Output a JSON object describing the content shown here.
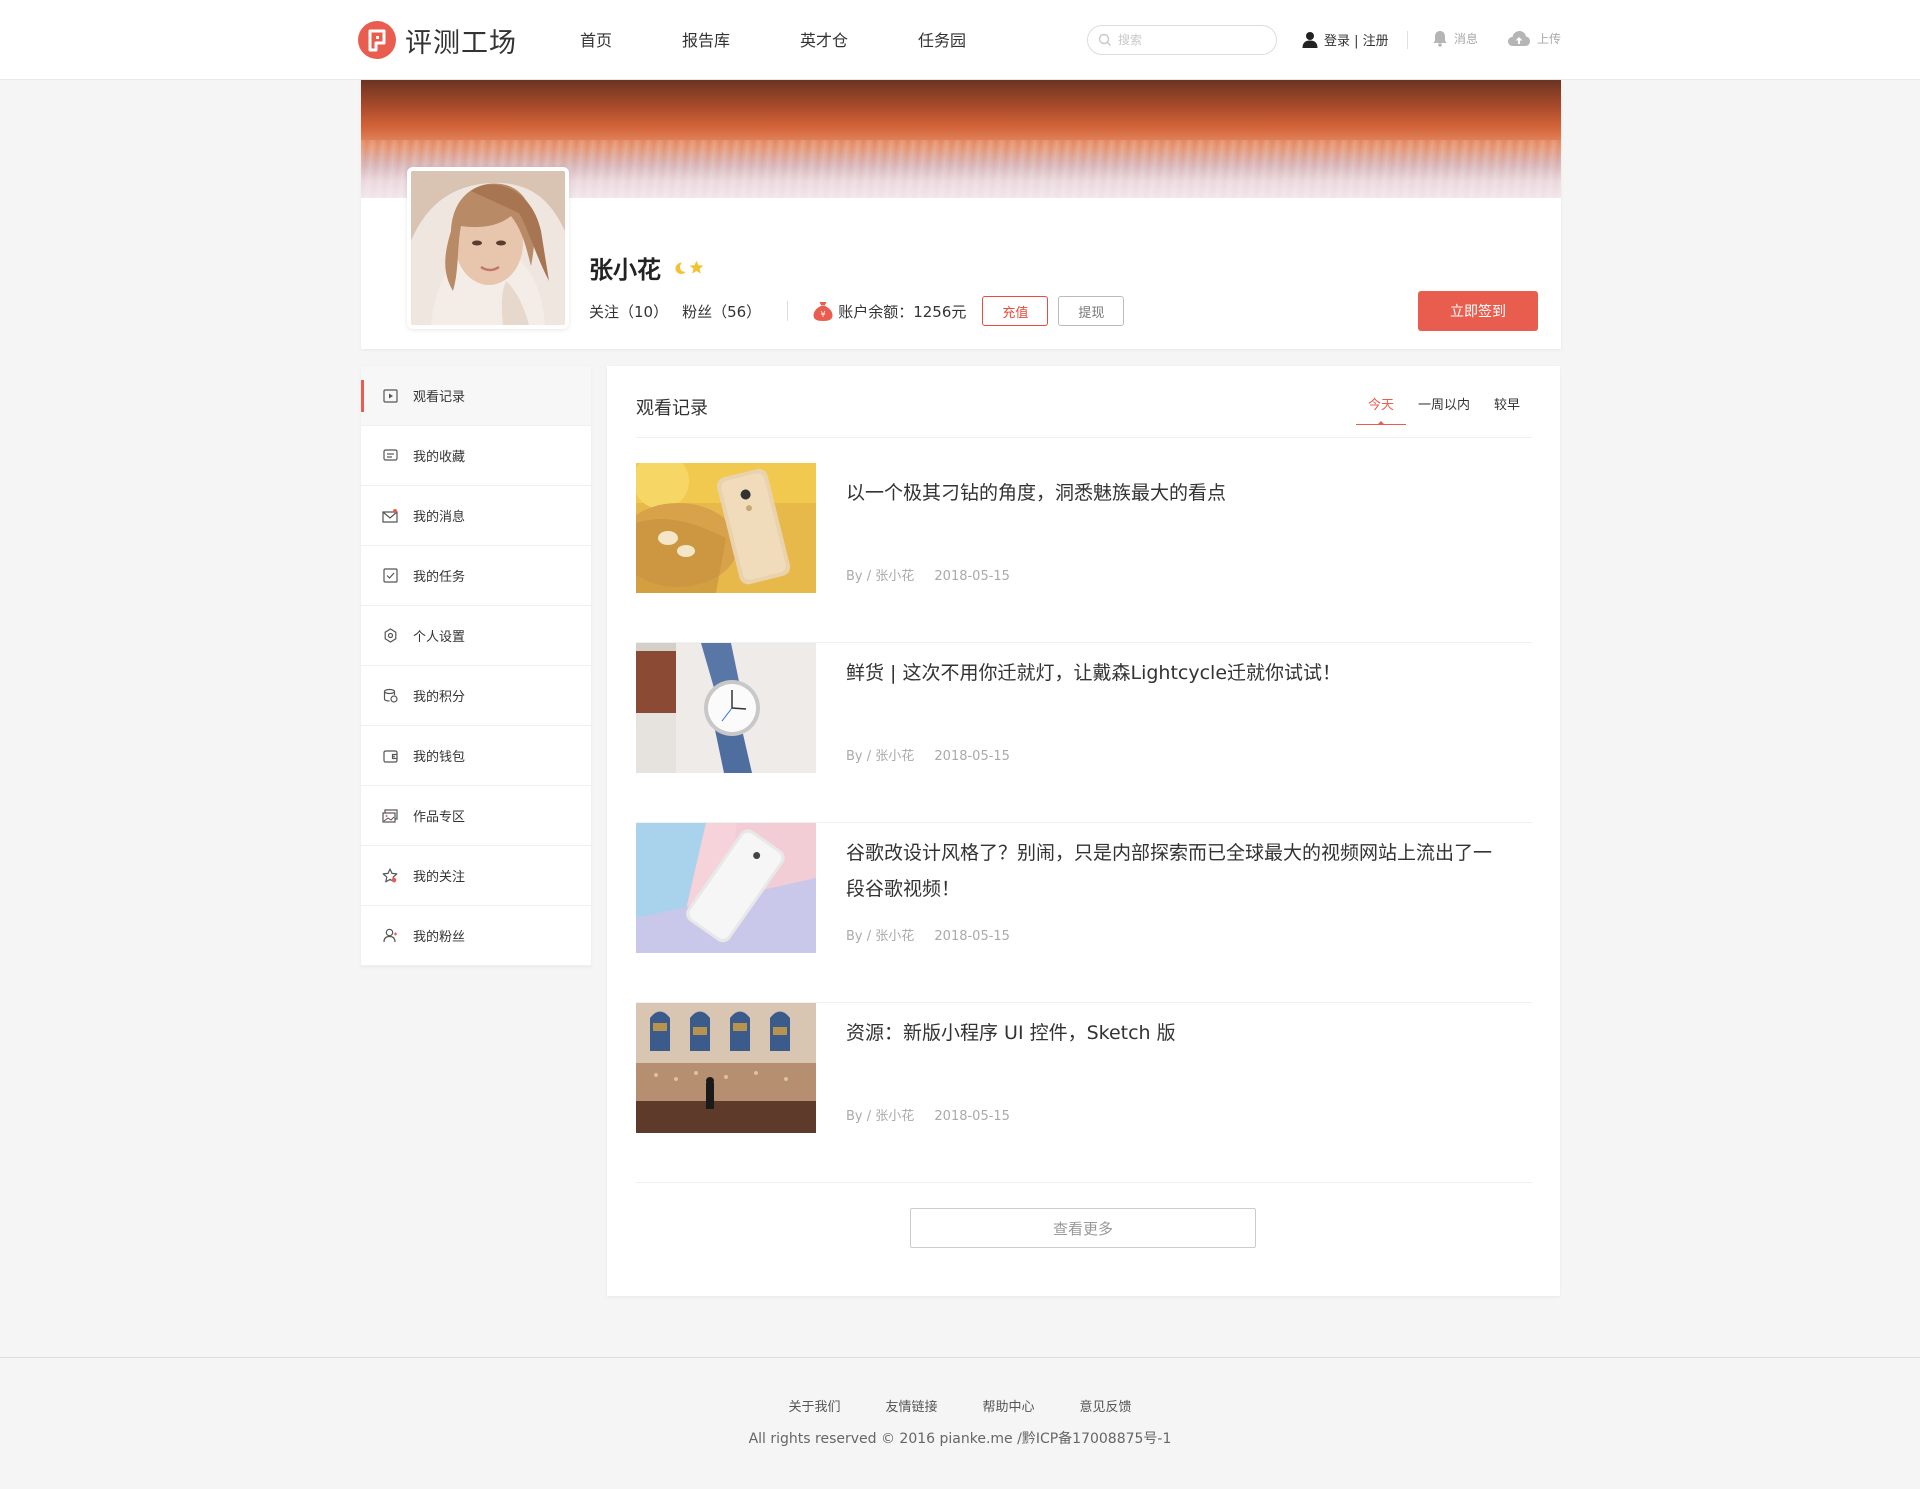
{
  "header": {
    "logo_text": "评测工场",
    "nav": [
      "首页",
      "报告库",
      "英才仓",
      "任务园"
    ],
    "search_placeholder": "搜索",
    "login_text": "登录 | 注册",
    "messages_label": "消息",
    "upload_label": "上传"
  },
  "profile": {
    "username": "张小花",
    "follow": "关注（10）",
    "fans": "粉丝（56）",
    "balance": "账户余额：1256元",
    "recharge_label": "充值",
    "withdraw_label": "提现",
    "checkin_label": "立即签到"
  },
  "sidebar": {
    "items": [
      {
        "label": "观看记录",
        "icon": "play-record-icon",
        "active": true
      },
      {
        "label": "我的收藏",
        "icon": "favorites-icon"
      },
      {
        "label": "我的消息",
        "icon": "message-icon"
      },
      {
        "label": "我的任务",
        "icon": "task-icon"
      },
      {
        "label": "个人设置",
        "icon": "settings-icon"
      },
      {
        "label": "我的积分",
        "icon": "points-icon"
      },
      {
        "label": "我的钱包",
        "icon": "wallet-icon"
      },
      {
        "label": "作品专区",
        "icon": "works-icon"
      },
      {
        "label": "我的关注",
        "icon": "follow-star-icon"
      },
      {
        "label": "我的粉丝",
        "icon": "fans-icon"
      }
    ]
  },
  "main": {
    "title": "观看记录",
    "tabs": [
      {
        "label": "今天",
        "active": true
      },
      {
        "label": "一周以内"
      },
      {
        "label": "较早"
      }
    ],
    "items": [
      {
        "title": "以一个极其刁钻的角度，洞悉魅族最大的看点",
        "author": "By / 张小花",
        "date": "2018-05-15"
      },
      {
        "title": "鲜货 | 这次不用你迁就灯，让戴森Lightcycle迁就你试试！",
        "author": "By / 张小花",
        "date": "2018-05-15"
      },
      {
        "title": "谷歌改设计风格了？别闹，只是内部探索而已全球最大的视频网站上流出了一段谷歌视频！",
        "author": "By / 张小花",
        "date": "2018-05-15"
      },
      {
        "title": "资源：新版小程序 UI 控件，Sketch 版",
        "author": "By / 张小花",
        "date": "2018-05-15"
      }
    ],
    "more_label": "查看更多"
  },
  "footer": {
    "links": [
      "关于我们",
      "友情链接",
      "帮助中心",
      "意见反馈"
    ],
    "copyright": "All rights reserved © 2016 pianke.me /黔ICP备17008875号-1"
  },
  "colors": {
    "accent": "#e95d4f",
    "badge_moon": "#f2c230",
    "badge_star": "#f2c230"
  }
}
